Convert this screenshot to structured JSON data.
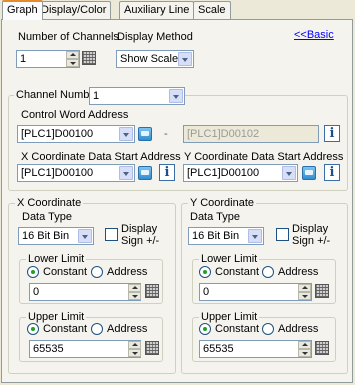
{
  "tabs": [
    "Graph",
    "Display/Color",
    "Auxiliary Line",
    "Scale"
  ],
  "active_tab": "Graph",
  "channels": {
    "label": "Number of Channels",
    "value": "1"
  },
  "display_method": {
    "label": "Display Method",
    "value": "Show Scale"
  },
  "basic_link": "<<Basic",
  "channel_number": {
    "label": "Channel Number",
    "value": "1"
  },
  "control_word": {
    "label": "Control Word Address",
    "value": "[PLC1]D00100",
    "separator": "-",
    "end_value": "[PLC1]D00102"
  },
  "x_start": {
    "label": "X Coordinate Data Start Address",
    "value": "[PLC1]D00100"
  },
  "y_start": {
    "label": "Y Coordinate Data Start Address",
    "value": "[PLC1]D00100"
  },
  "x_coord": {
    "title": "X Coordinate",
    "data_type_label": "Data Type",
    "data_type": "16 Bit Bin",
    "display_sign": "Display Sign +/-",
    "lower": {
      "title": "Lower Limit",
      "constant": "Constant",
      "address": "Address",
      "value": "0"
    },
    "upper": {
      "title": "Upper Limit",
      "constant": "Constant",
      "address": "Address",
      "value": "65535"
    }
  },
  "y_coord": {
    "title": "Y Coordinate",
    "data_type_label": "Data Type",
    "data_type": "16 Bit Bin",
    "display_sign": "Display Sign +/-",
    "lower": {
      "title": "Lower Limit",
      "constant": "Constant",
      "address": "Address",
      "value": "0"
    },
    "upper": {
      "title": "Upper Limit",
      "constant": "Constant",
      "address": "Address",
      "value": "65535"
    }
  }
}
